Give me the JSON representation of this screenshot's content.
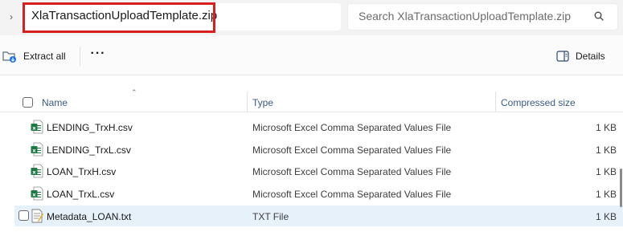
{
  "address": {
    "chevron": "›",
    "breadcrumb": "XlaTransactionUploadTemplate.zip",
    "search_placeholder": "Search XlaTransactionUploadTemplate.zip"
  },
  "toolbar": {
    "extract_label": "Extract all",
    "more_label": "···",
    "details_label": "Details"
  },
  "columns": {
    "name": "Name",
    "type": "Type",
    "size": "Compressed size"
  },
  "files": [
    {
      "name": "LENDING_TrxH.csv",
      "type": "Microsoft Excel Comma Separated Values File",
      "size": "1 KB",
      "icon": "excel-csv-icon"
    },
    {
      "name": "LENDING_TrxL.csv",
      "type": "Microsoft Excel Comma Separated Values File",
      "size": "1 KB",
      "icon": "excel-csv-icon"
    },
    {
      "name": "LOAN_TrxH.csv",
      "type": "Microsoft Excel Comma Separated Values File",
      "size": "1 KB",
      "icon": "excel-csv-icon"
    },
    {
      "name": "LOAN_TrxL.csv",
      "type": "Microsoft Excel Comma Separated Values File",
      "size": "1 KB",
      "icon": "excel-csv-icon"
    },
    {
      "name": "Metadata_LOAN.txt",
      "type": "TXT File",
      "size": "1 KB",
      "icon": "text-file-icon"
    }
  ],
  "colors": {
    "highlight": "#d81e1e",
    "excel_green": "#1d7a43",
    "selected_row": "#e7f1fa",
    "header_text": "#3a5a8c"
  }
}
